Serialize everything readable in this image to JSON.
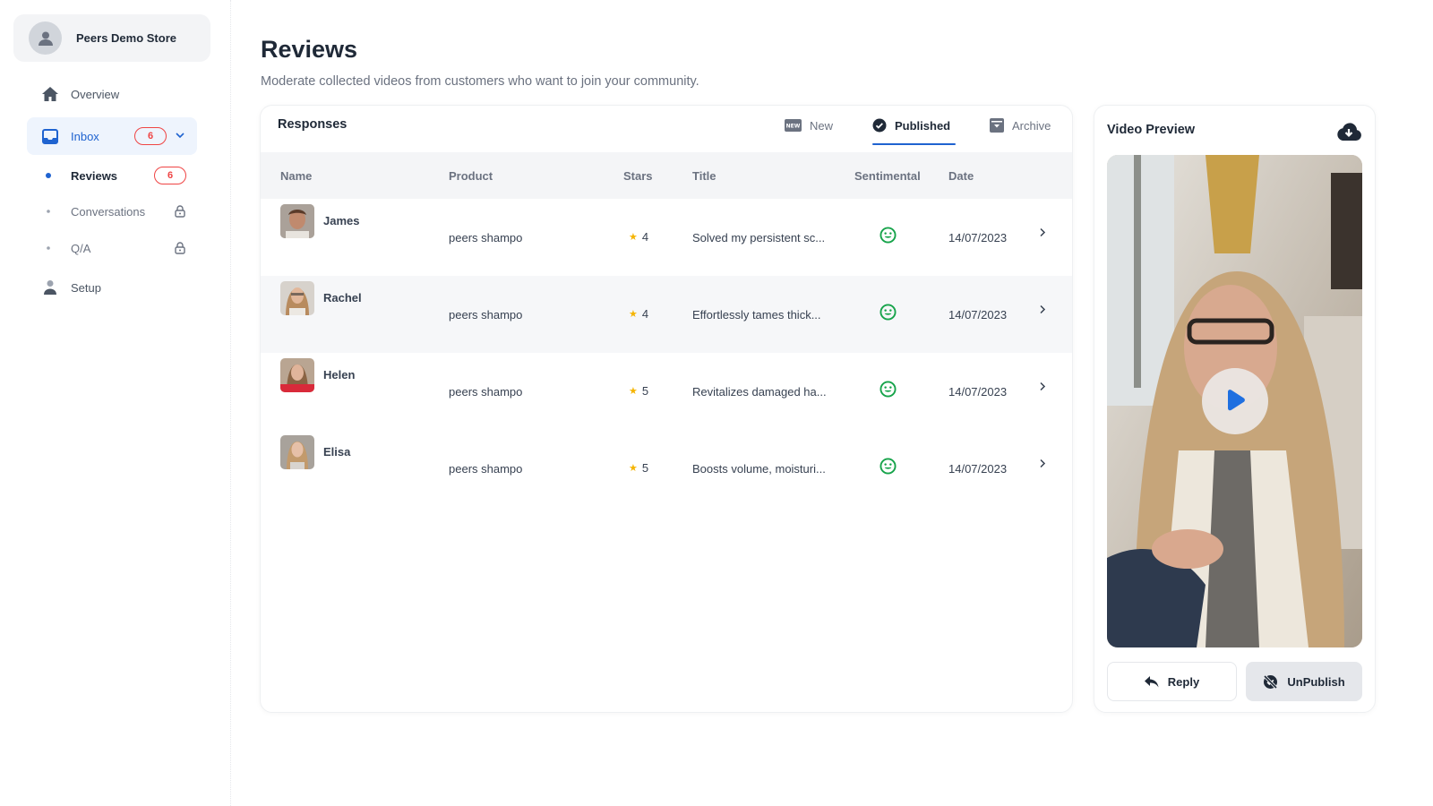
{
  "sidebar": {
    "store_name": "Peers Demo Store",
    "nav": [
      {
        "label": "Overview",
        "icon": "home-icon"
      },
      {
        "label": "Inbox",
        "icon": "inbox-icon",
        "badge": "6",
        "expanded": true
      },
      {
        "label": "Setup",
        "icon": "user-icon"
      }
    ],
    "inbox_children": [
      {
        "label": "Reviews",
        "badge": "6",
        "active": true
      },
      {
        "label": "Conversations",
        "locked": true
      },
      {
        "label": "Q/A",
        "locked": true
      }
    ]
  },
  "header": {
    "title": "Reviews",
    "subtitle": "Moderate collected videos from customers who want to join your community."
  },
  "responses": {
    "title": "Responses",
    "tabs": [
      {
        "label": "New",
        "icon": "new-badge-icon"
      },
      {
        "label": "Published",
        "icon": "check-circle-icon",
        "active": true
      },
      {
        "label": "Archive",
        "icon": "archive-icon"
      }
    ],
    "columns": [
      "Name",
      "Product",
      "Stars",
      "Title",
      "Sentimental",
      "Date"
    ],
    "rows": [
      {
        "name": "James",
        "product": "peers shampo",
        "stars": "4",
        "title": "Solved my persistent sc...",
        "sentiment": "positive",
        "date": "14/07/2023"
      },
      {
        "name": "Rachel",
        "product": "peers shampo",
        "stars": "4",
        "title": "Effortlessly tames thick...",
        "sentiment": "positive",
        "date": "14/07/2023"
      },
      {
        "name": "Helen",
        "product": "peers shampo",
        "stars": "5",
        "title": "Revitalizes damaged ha...",
        "sentiment": "positive",
        "date": "14/07/2023"
      },
      {
        "name": "Elisa",
        "product": "peers shampo",
        "stars": "5",
        "title": "Boosts volume, moisturi...",
        "sentiment": "positive",
        "date": "14/07/2023"
      }
    ]
  },
  "video_preview": {
    "title": "Video Preview",
    "reply_label": "Reply",
    "unpublish_label": "UnPublish"
  },
  "colors": {
    "accent": "#1f63d0",
    "badge": "#ef4444",
    "star": "#f5b400",
    "positive": "#16a34a"
  }
}
